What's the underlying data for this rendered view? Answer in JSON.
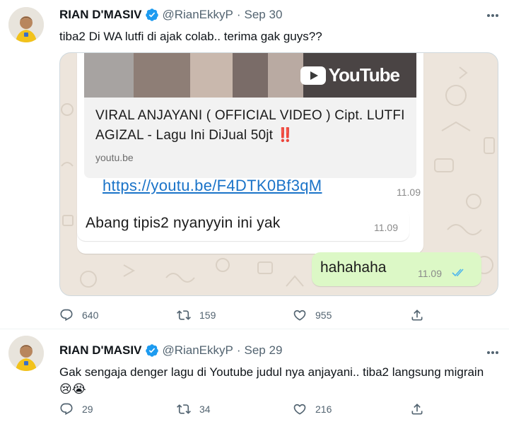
{
  "tweets": [
    {
      "author": {
        "name": "RIAN D'MASIV",
        "handle": "@RianEkkyP",
        "verified": true
      },
      "date": "Sep 30",
      "text": "tiba2 Di WA lutfi di ajak colab.. terima gak guys??",
      "media": {
        "type": "whatsapp-chat-screenshot",
        "link_preview": {
          "thumbnail_brand": "YouTube",
          "title": "VIRAL ANJAYANI ( OFFICIAL VIDEO ) Cipt. LUTFI AGIZAL - Lagu Ini DiJual 50jt ‼️",
          "domain": "youtu.be"
        },
        "messages": [
          {
            "direction": "incoming",
            "text": "https://youtu.be/F4DTK0Bf3qM",
            "time": "11.09"
          },
          {
            "direction": "incoming",
            "text": "Abang tipis2 nyanyyin ini yak",
            "time": "11.09"
          },
          {
            "direction": "outgoing",
            "text": "hahahaha",
            "time": "11.09",
            "read": true
          }
        ]
      },
      "stats": {
        "replies": "640",
        "retweets": "159",
        "likes": "955"
      }
    },
    {
      "author": {
        "name": "RIAN D'MASIV",
        "handle": "@RianEkkyP",
        "verified": true
      },
      "date": "Sep 29",
      "text": "Gak sengaja denger lagu di Youtube judul nya anjayani.. tiba2 langsung migrain 😢😭",
      "stats": {
        "replies": "29",
        "retweets": "34",
        "likes": "216"
      }
    }
  ],
  "colors": {
    "verified": "#1d9bf0",
    "muted_text": "#536471",
    "wa_background": "#ede5dc",
    "wa_outgoing": "#dcf8c6",
    "wa_link": "#1a73c8",
    "wa_read_ticks": "#4fb6ec"
  },
  "icons": [
    "more-icon",
    "verified-icon",
    "reply-icon",
    "retweet-icon",
    "like-icon",
    "share-icon",
    "youtube-icon",
    "double-check-icon"
  ]
}
